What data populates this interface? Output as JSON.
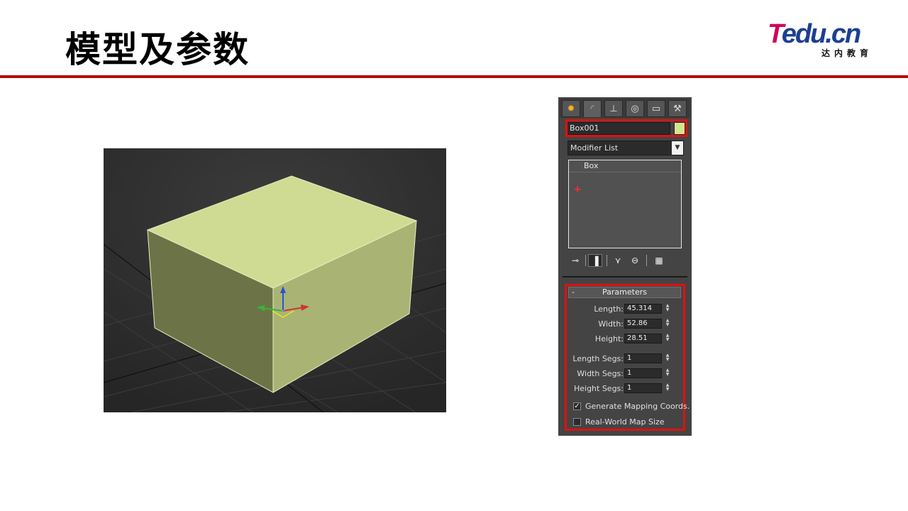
{
  "slide": {
    "title": "模型及参数"
  },
  "logo": {
    "brand_t": "T",
    "brand_rest": "edu.cn",
    "subtitle": "达内教育"
  },
  "colors": {
    "accent": "#b50d0d",
    "highlight": "#e01010",
    "box_color": "#d7e48f"
  },
  "command_panel": {
    "tabs": [
      {
        "icon": "create-icon"
      },
      {
        "icon": "modify-icon"
      },
      {
        "icon": "hierarchy-icon"
      },
      {
        "icon": "motion-icon"
      },
      {
        "icon": "display-icon"
      },
      {
        "icon": "utilities-icon"
      }
    ],
    "object_name": "Box001",
    "modifier_list_label": "Modifier List",
    "stack": {
      "item": "Box",
      "marker": "+"
    },
    "parameters": {
      "header": "Parameters",
      "collapse_symbol": "-",
      "length_label": "Length:",
      "length_value": "45.314",
      "width_label": "Width:",
      "width_value": "52.86",
      "height_label": "Height:",
      "height_value": "28.51",
      "length_segs_label": "Length Segs:",
      "length_segs_value": "1",
      "width_segs_label": "Width Segs:",
      "width_segs_value": "1",
      "height_segs_label": "Height Segs:",
      "height_segs_value": "1",
      "gen_mapping_label": "Generate Mapping Coords.",
      "gen_mapping_checked": true,
      "real_world_label": "Real-World Map Size",
      "real_world_checked": false
    }
  }
}
